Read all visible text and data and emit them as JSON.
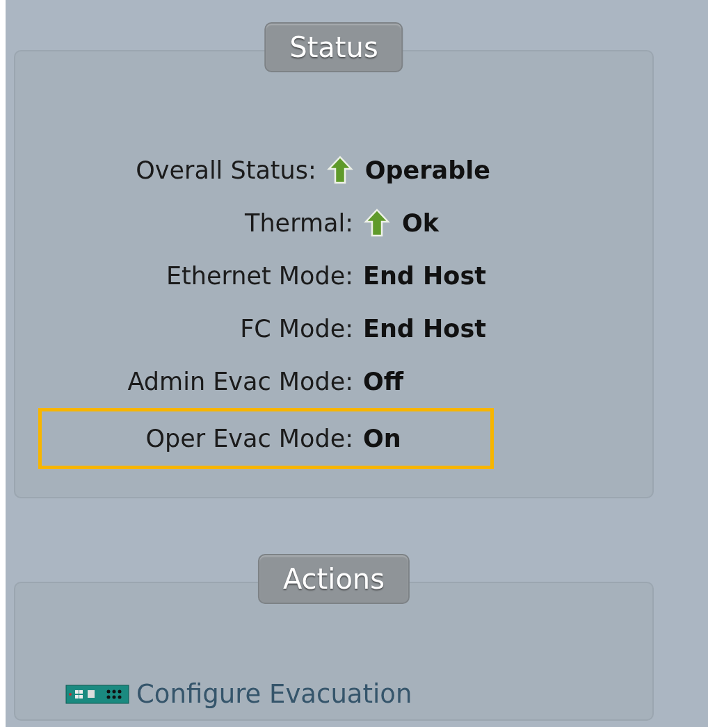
{
  "status_panel": {
    "title": "Status",
    "rows": [
      {
        "label": "Overall Status:",
        "kind": "indicator",
        "value": "Operable",
        "highlighted": false
      },
      {
        "label": "Thermal:",
        "kind": "indicator",
        "value": "Ok",
        "highlighted": false
      },
      {
        "label": "Ethernet Mode:",
        "kind": "plain",
        "value": "End Host",
        "highlighted": false
      },
      {
        "label": "FC Mode:",
        "kind": "plain",
        "value": "End Host",
        "highlighted": false
      },
      {
        "label": "Admin Evac Mode:",
        "kind": "plain",
        "value": "Off",
        "highlighted": false
      },
      {
        "label": "Oper Evac Mode:",
        "kind": "plain",
        "value": "On",
        "highlighted": true
      }
    ]
  },
  "actions_panel": {
    "title": "Actions",
    "links": [
      {
        "label": "Configure Evacuation"
      }
    ]
  }
}
